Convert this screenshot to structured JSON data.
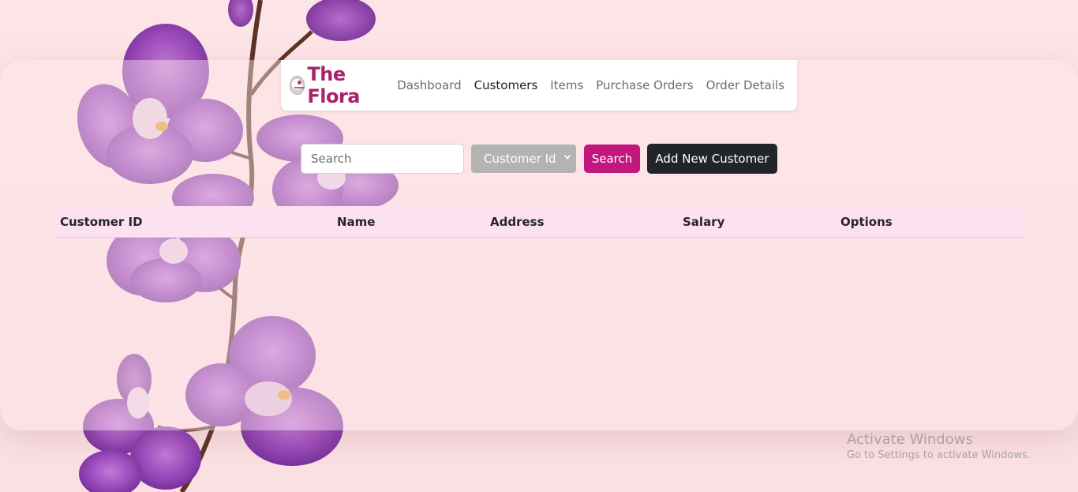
{
  "brand": {
    "name": "The Flora",
    "logo_icon": "flora-logo-icon",
    "color": "#a6236a"
  },
  "nav": {
    "items": [
      {
        "label": "Dashboard",
        "active": false
      },
      {
        "label": "Customers",
        "active": true
      },
      {
        "label": "Items",
        "active": false
      },
      {
        "label": "Purchase Orders",
        "active": false
      },
      {
        "label": "Order Details",
        "active": false
      }
    ]
  },
  "controls": {
    "search_placeholder": "Search",
    "search_value": "",
    "filter_selected": "Customer Id",
    "search_button": "Search",
    "add_button": "Add New Customer",
    "search_button_color": "#c2187e",
    "add_button_color": "#212429"
  },
  "table": {
    "columns": [
      "Customer ID",
      "Name",
      "Address",
      "Salary",
      "Options"
    ],
    "rows": [],
    "header_color": "#fde1f1"
  },
  "watermark": {
    "title": "Activate Windows",
    "subtitle": "Go to Settings to activate Windows."
  },
  "background": {
    "image": "purple-orchid-branch",
    "color": "#fde3e6"
  }
}
